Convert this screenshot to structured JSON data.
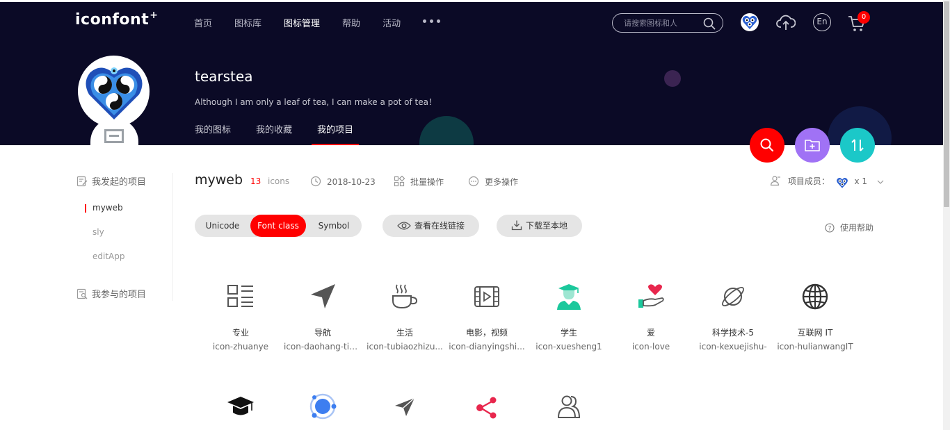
{
  "header": {
    "logo": "iconfont",
    "logo_plus": "+",
    "nav": [
      "首页",
      "图标库",
      "图标管理",
      "帮助",
      "活动"
    ],
    "active_nav": "图标管理",
    "search_placeholder": "请搜索图标和人",
    "lang_label": "En",
    "cart_count": "0"
  },
  "profile": {
    "username": "tearstea",
    "tagline": "Although I am only a leaf of tea, I can make a pot of tea！",
    "tabs": [
      "我的图标",
      "我的收藏",
      "我的项目"
    ],
    "active_tab": "我的项目"
  },
  "sidebar": {
    "initiated_title": "我发起的项目",
    "projects": [
      "myweb",
      "sly",
      "editApp"
    ],
    "active_project": "myweb",
    "joined_title": "我参与的项目"
  },
  "project": {
    "name": "myweb",
    "count": "13",
    "count_unit": "icons",
    "date": "2018-10-23",
    "batch_label": "批量操作",
    "more_label": "更多操作",
    "members_label": "项目成员：",
    "members_count": "x 1"
  },
  "toolbar": {
    "modes": [
      "Unicode",
      "Font class",
      "Symbol"
    ],
    "active_mode": "Font class",
    "view_online_label": "查看在线链接",
    "download_label": "下载至本地",
    "help_label": "使用帮助"
  },
  "icons": [
    {
      "name": "专业",
      "code": "icon-zhuanye",
      "icon": "list-icon"
    },
    {
      "name": "导航",
      "code": "icon-daohang-tia...",
      "icon": "navigation-arrow-icon"
    },
    {
      "name": "生活",
      "code": "icon-tubiaozhizu...",
      "icon": "coffee-cup-icon"
    },
    {
      "name": "电影，视频",
      "code": "icon-dianyingshi...",
      "icon": "film-icon"
    },
    {
      "name": "学生",
      "code": "icon-xuesheng1",
      "icon": "student-icon"
    },
    {
      "name": "爱",
      "code": "icon-love",
      "icon": "hand-heart-icon"
    },
    {
      "name": "科学技术-5",
      "code": "icon-kexuejishu-",
      "icon": "planet-icon"
    },
    {
      "name": "互联网 IT",
      "code": "icon-hulianwangIT",
      "icon": "globe-icon"
    },
    {
      "name": "",
      "code": "",
      "icon": "graduation-cap-icon"
    },
    {
      "name": "",
      "code": "",
      "icon": "orbit-icon"
    },
    {
      "name": "",
      "code": "",
      "icon": "paper-plane-icon"
    },
    {
      "name": "",
      "code": "",
      "icon": "share-icon"
    },
    {
      "name": "",
      "code": "",
      "icon": "users-icon"
    }
  ],
  "colors": {
    "header_bg": "#0b0a26",
    "accent_red": "#ff0000",
    "fab_search": "#ff0000",
    "fab_folder": "#a072f5",
    "fab_sort": "#1bc8c8",
    "student_green": "#1bc89c"
  }
}
